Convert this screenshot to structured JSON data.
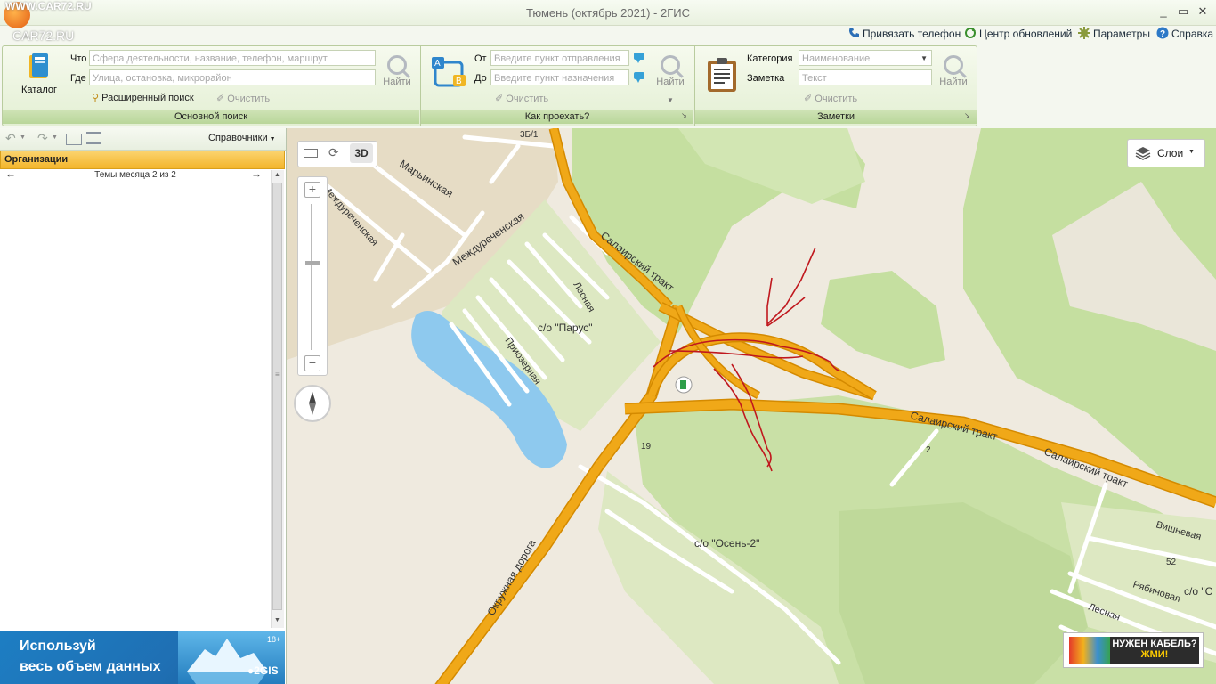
{
  "window": {
    "title": "Тюмень (октябрь 2021) - 2ГИС",
    "watermark_top": "WWW.CAR72.RU",
    "watermark_logo": "CAR72.RU",
    "controls": [
      "_",
      "▭",
      "✕"
    ]
  },
  "toplinks": [
    {
      "label": "Привязать телефон",
      "icon": "phone-icon"
    },
    {
      "label": "Центр обновлений",
      "icon": "refresh-icon"
    },
    {
      "label": "Параметры",
      "icon": "gear-icon"
    },
    {
      "label": "Справка",
      "icon": "help-icon"
    }
  ],
  "search": {
    "catalog_label": "Каталог",
    "what_label": "Что",
    "what_placeholder": "Сфера деятельности, название, телефон, маршрут",
    "where_label": "Где",
    "where_placeholder": "Улица, остановка, микрорайон",
    "find_label": "Найти",
    "advanced_label": "Расширенный поиск",
    "clear_label": "Очистить",
    "group_label": "Основной поиск"
  },
  "route": {
    "from_label": "От",
    "from_placeholder": "Введите пункт отправления",
    "to_label": "До",
    "to_placeholder": "Введите пункт назначения",
    "find_label": "Найти",
    "clear_label": "Очистить",
    "group_label": "Как проехать?"
  },
  "notes": {
    "category_label": "Категория",
    "category_value": "Наименование",
    "note_label": "Заметка",
    "note_placeholder": "Текст",
    "find_label": "Найти",
    "clear_label": "Очистить",
    "group_label": "Заметки"
  },
  "sidebar": {
    "directories_label": "Справочники",
    "organizations_label": "Организации",
    "themes_label": "Темы месяца 2 из 2",
    "banner": {
      "line1": "Используй",
      "line2": "весь объем данных",
      "age": "18+",
      "brand": "2GIS"
    }
  },
  "map": {
    "layers_label": "Слои",
    "mode_3d": "3D",
    "ad_line1": "НУЖЕН КАБЕЛЬ?",
    "ad_line2": "ЖМИ!",
    "labels": {
      "num_3b1": "3Б/1",
      "maryinskaya": "Марьинская",
      "mezhdurechenskaya_1": "Междуреченская",
      "mezhdurechenskaya_2": "Междуреченская",
      "lesnaya_1": "Лесная",
      "salair_1": "Салаирский тракт",
      "salair_2": "Салаирский тракт",
      "salair_3": "Салаирский тракт",
      "parus": "с/о \"Парус\"",
      "prioz": "Приозерная",
      "num_19": "19",
      "num_2": "2",
      "okruzh": "Окружная дорога",
      "osen": "с/о \"Осень-2\"",
      "vishnevaya": "Вишневая",
      "num_52": "52",
      "ryabinovaya": "Рябиновая",
      "so_c": "с/о \"С",
      "lesnaya_2": "Лесная"
    },
    "colors": {
      "road": "#f0a818",
      "road_edge": "#d48a00",
      "forest": "#c5dfa0",
      "water": "#8ec9ee",
      "sketch": "#c0181e"
    }
  }
}
